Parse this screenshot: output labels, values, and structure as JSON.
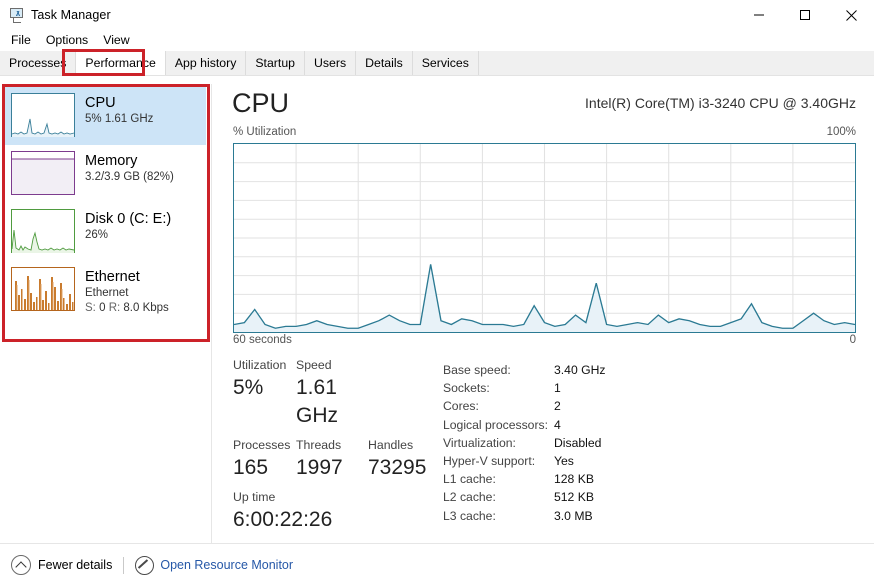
{
  "window": {
    "title": "Task Manager",
    "icon": "task-manager-icon",
    "controls": {
      "minimize": "—",
      "maximize": "□",
      "close": "✕"
    }
  },
  "menu": {
    "items": [
      "File",
      "Options",
      "View"
    ]
  },
  "tabs": {
    "items": [
      "Processes",
      "Performance",
      "App history",
      "Startup",
      "Users",
      "Details",
      "Services"
    ],
    "active": "Performance"
  },
  "annotations": {
    "color": "#cc2229",
    "targets": [
      "Performance",
      "resource-sidebar"
    ]
  },
  "sidebar": {
    "items": [
      {
        "name": "CPU",
        "sub": "5%  1.61 GHz",
        "sub2": "",
        "selected": true,
        "color": "#2b7a93",
        "graph": "line"
      },
      {
        "name": "Memory",
        "sub": "3.2/3.9 GB (82%)",
        "sub2": "",
        "selected": false,
        "color": "#7d3c8e",
        "graph": "fill"
      },
      {
        "name": "Disk 0 (C: E:)",
        "sub": "26%",
        "sub2": "",
        "selected": false,
        "color": "#3b8a2e",
        "graph": "line"
      },
      {
        "name": "Ethernet",
        "sub": "Ethernet",
        "sub2_label_s": "S:",
        "sub2_val_s": "0",
        "sub2_label_r": "R:",
        "sub2_val_r": "8.0 Kbps",
        "selected": false,
        "color": "#b5651d",
        "graph": "bars"
      }
    ]
  },
  "main": {
    "title": "CPU",
    "model": "Intel(R) Core(TM) i3-3240 CPU @ 3.40GHz",
    "chart_axis_left": "% Utilization",
    "chart_axis_right": "100%",
    "chart_foot_left": "60 seconds",
    "chart_foot_right": "0",
    "stats_primary": [
      [
        {
          "label": "Utilization",
          "value": "5%"
        },
        {
          "label": "Speed",
          "value": "1.61 GHz"
        }
      ],
      [
        {
          "label": "Processes",
          "value": "165"
        },
        {
          "label": "Threads",
          "value": "1997"
        },
        {
          "label": "Handles",
          "value": "73295"
        }
      ],
      [
        {
          "label": "Up time",
          "value": "6:00:22:26"
        }
      ]
    ],
    "stats_secondary": [
      {
        "label": "Base speed:",
        "value": "3.40 GHz"
      },
      {
        "label": "Sockets:",
        "value": "1"
      },
      {
        "label": "Cores:",
        "value": "2"
      },
      {
        "label": "Logical processors:",
        "value": "4"
      },
      {
        "label": "Virtualization:",
        "value": "Disabled"
      },
      {
        "label": "Hyper-V support:",
        "value": "Yes"
      },
      {
        "label": "L1 cache:",
        "value": "128 KB"
      },
      {
        "label": "L2 cache:",
        "value": "512 KB"
      },
      {
        "label": "L3 cache:",
        "value": "3.0 MB"
      }
    ]
  },
  "footer": {
    "fewer_details": "Fewer details",
    "fewer_details_icon": "chevron-up-circle-icon",
    "resource_monitor": "Open Resource Monitor",
    "resource_monitor_icon": "resource-monitor-icon",
    "link_color": "#2557a7"
  },
  "chart_data": {
    "type": "area",
    "title": "CPU % Utilization over 60 seconds",
    "xlabel": "60 seconds",
    "ylabel": "% Utilization",
    "ylim": [
      0,
      100
    ],
    "xlim": [
      60,
      0
    ],
    "grid": true,
    "grid_cols": 10,
    "grid_rows": 10,
    "line_color": "#2b7a93",
    "fill_color": "#e8f2f8",
    "series": [
      {
        "name": "CPU utilization",
        "values": [
          4,
          5,
          12,
          4,
          2,
          3,
          3,
          4,
          6,
          4,
          3,
          2,
          2,
          4,
          6,
          9,
          6,
          4,
          4,
          36,
          6,
          4,
          7,
          6,
          4,
          4,
          4,
          3,
          4,
          14,
          5,
          3,
          4,
          9,
          5,
          26,
          4,
          3,
          4,
          5,
          4,
          9,
          5,
          7,
          6,
          4,
          3,
          3,
          5,
          7,
          15,
          5,
          3,
          2,
          2,
          6,
          10,
          6,
          4,
          5,
          4
        ]
      }
    ]
  }
}
